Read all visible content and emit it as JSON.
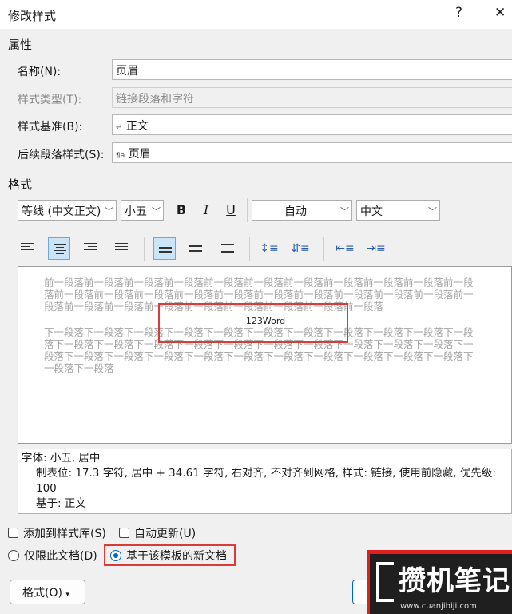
{
  "dialog": {
    "title": "修改样式",
    "help_label": "?",
    "close_label": "✕"
  },
  "properties": {
    "section_label": "属性",
    "name_label": "名称(N):",
    "name_value": "页眉",
    "style_type_label": "样式类型(T):",
    "style_type_value": "链接段落和字符",
    "style_based_label": "样式基准(B):",
    "style_based_value": "正文",
    "next_style_label": "后续段落样式(S):",
    "next_style_value": "页眉"
  },
  "format": {
    "section_label": "格式",
    "font": "等线 (中文正文)",
    "size": "小五",
    "bold": "B",
    "italic": "I",
    "underline": "U",
    "color": "自动",
    "script": "中文"
  },
  "preview": {
    "prev_text": "前一段落前一段落前一段落前一段落前一段落前一段落前一段落前一段落前一段落前一段落前一段落前一段落前一段落前一段落前一段落前一段落前一段落前一段落前一段落前一段落前一段落前一段落前一段落前一段落前一段落前一段落前一段落前一段落前一段落前一段落",
    "sample_text": "123Word",
    "next_text": "下一段落下一段落下一段落下一段落下一段落下一段落下一段落下一段落下一段落下一段落下一段落下一段落下一段落下一段落下一段落下一段落下一段落下一段落下一段落下一段落下一段落下一段落下一段落下一段落下一段落下一段落下一段落下一段落下一段落下一段落下一段落下一段落下一段落下一段落"
  },
  "description": {
    "line1": "字体: 小五, 居中",
    "line2": "制表位:  17.3 字符, 居中 +   34.61 字符, 右对齐, 不对齐到网格, 样式: 链接, 使用前隐藏, 优先级: 100",
    "line3": "基于: 正文"
  },
  "options": {
    "add_to_gallery": "添加到样式库(S)",
    "auto_update": "自动更新(U)",
    "this_document_only": "仅限此文档(D)",
    "new_docs_template": "基于该模板的新文档"
  },
  "buttons": {
    "format": "格式(O)"
  },
  "watermark": {
    "main": "攒机笔记",
    "url": "www.cuanjibiji.com"
  }
}
